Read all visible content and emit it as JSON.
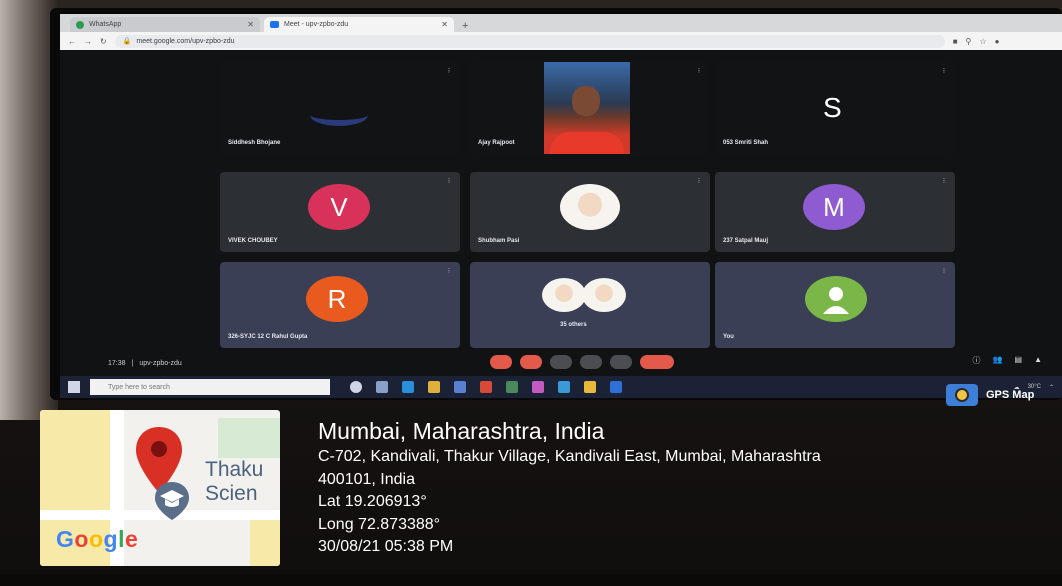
{
  "browser": {
    "tabs": [
      {
        "label": "WhatsApp"
      },
      {
        "label": "Meet - upv-zpbo-zdu"
      }
    ],
    "url": "meet.google.com/upv-zpbo-zdu"
  },
  "meet": {
    "participants": [
      {
        "name": "Siddhesh Bhojane"
      },
      {
        "name": "Ajay Rajpoot"
      },
      {
        "name": "053 Smriti Shah",
        "initial": "S"
      },
      {
        "name": "VIVEK CHOUBEY",
        "initial": "V",
        "color": "#d8325a"
      },
      {
        "name": "Shubham Pasi"
      },
      {
        "name": "237 Satpal Mauj",
        "initial": "M",
        "color": "#8e5bd0"
      },
      {
        "name": "326-SYJC 12 C Rahul Gupta",
        "initial": "R",
        "color": "#e85a1e"
      },
      {
        "name": "35 others"
      },
      {
        "name": "You"
      }
    ],
    "time": "17:38",
    "meeting_code": "upv-zpbo-zdu"
  },
  "taskbar": {
    "search_placeholder": "Type here to search",
    "weather": "30°C"
  },
  "gps": {
    "app_label": "GPS Map",
    "map_place_line1": "Thaku",
    "map_place_line2": "Scien",
    "map_logo": "Google",
    "city": "Mumbai, Maharashtra, India",
    "address_line1": "C-702, Kandivali, Thakur Village, Kandivali East, Mumbai, Maharashtra",
    "address_line2": "400101, India",
    "lat": "Lat 19.206913°",
    "long": "Long 72.873388°",
    "datetime": "30/08/21 05:38 PM"
  },
  "colors": {
    "meet_background": "#111214",
    "tile": "#2c2f33",
    "pin_red": "#d93025"
  }
}
